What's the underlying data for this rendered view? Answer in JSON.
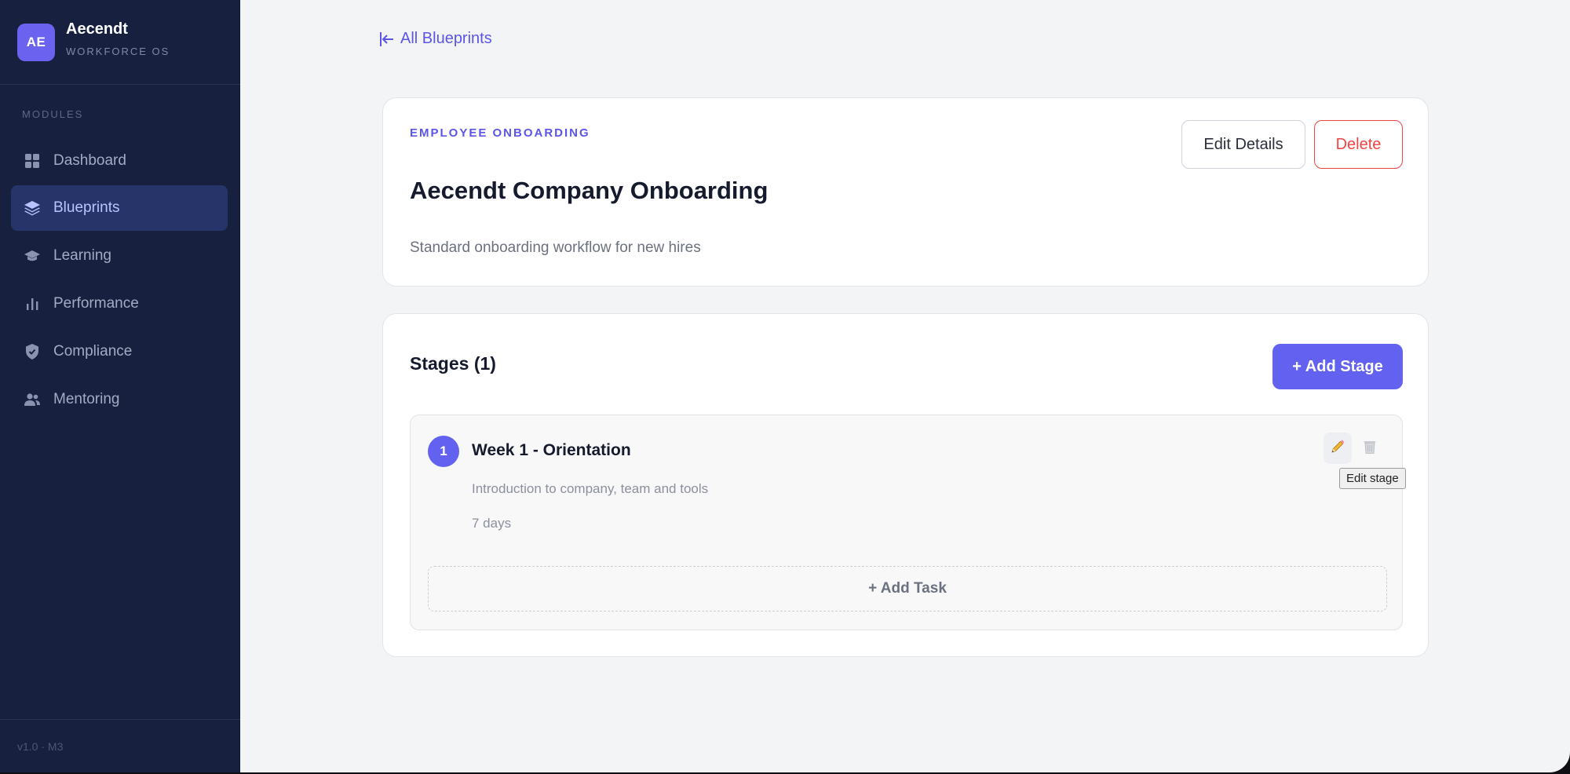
{
  "sidebar": {
    "logo_initials": "AE",
    "brand_name": "Aecendt",
    "brand_sub": "WORKFORCE OS",
    "section_label": "MODULES",
    "items": [
      {
        "label": "Dashboard",
        "icon": "grid-icon",
        "active": false
      },
      {
        "label": "Blueprints",
        "icon": "layers-icon",
        "active": true
      },
      {
        "label": "Learning",
        "icon": "graduation-cap-icon",
        "active": false
      },
      {
        "label": "Performance",
        "icon": "bar-chart-icon",
        "active": false
      },
      {
        "label": "Compliance",
        "icon": "shield-check-icon",
        "active": false
      },
      {
        "label": "Mentoring",
        "icon": "users-icon",
        "active": false
      }
    ],
    "version": "v1.0 · M3"
  },
  "main": {
    "back_link": "All Blueprints",
    "blueprint": {
      "category": "EMPLOYEE ONBOARDING",
      "title": "Aecendt Company Onboarding",
      "description": "Standard onboarding workflow for new hires",
      "edit_label": "Edit Details",
      "delete_label": "Delete"
    },
    "stages_section": {
      "title": "Stages (1)",
      "add_stage_label": "+ Add Stage",
      "stages": [
        {
          "number": "1",
          "name": "Week 1 - Orientation",
          "description": "Introduction to company, team and tools",
          "duration": "7 days",
          "add_task_label": "+ Add Task",
          "tooltip": "Edit stage"
        }
      ]
    }
  },
  "colors": {
    "accent": "#6361f0",
    "sidebar_bg": "#17213f",
    "danger": "#ef4444",
    "page_bg": "#f3f4f6"
  }
}
